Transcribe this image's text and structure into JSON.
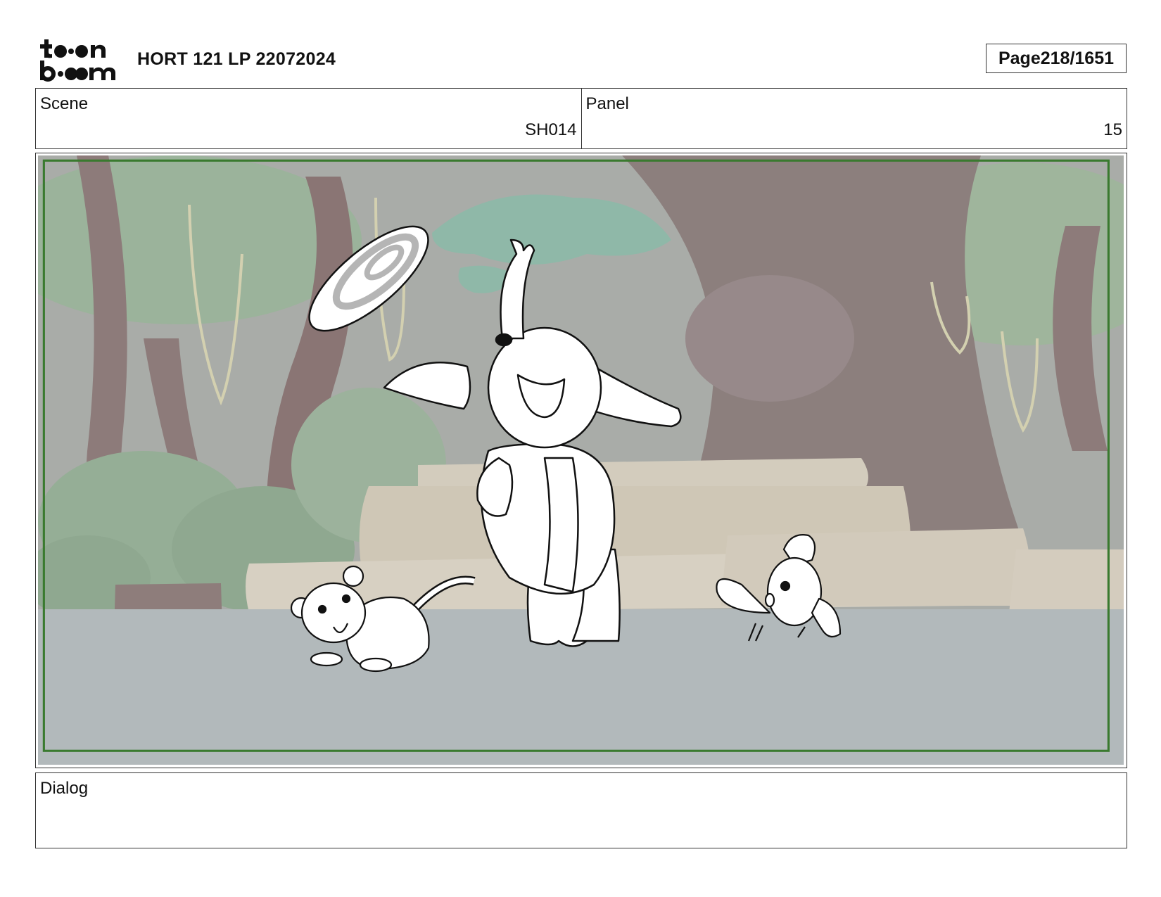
{
  "header": {
    "logo_text": "toon boom",
    "doc_title": "HORT 121 LP 22072024",
    "page_label": "Page",
    "page_number": "218/1651"
  },
  "info": {
    "scene_label": "Scene",
    "scene_value": "SH014",
    "panel_label": "Panel",
    "panel_value": "15"
  },
  "dialog": {
    "label": "Dialog",
    "text": ""
  },
  "colors": {
    "border": "#333333",
    "safe_frame": "#3a7a2f",
    "ground": "#b2b9bb",
    "background_tint": "#a9aca8"
  }
}
